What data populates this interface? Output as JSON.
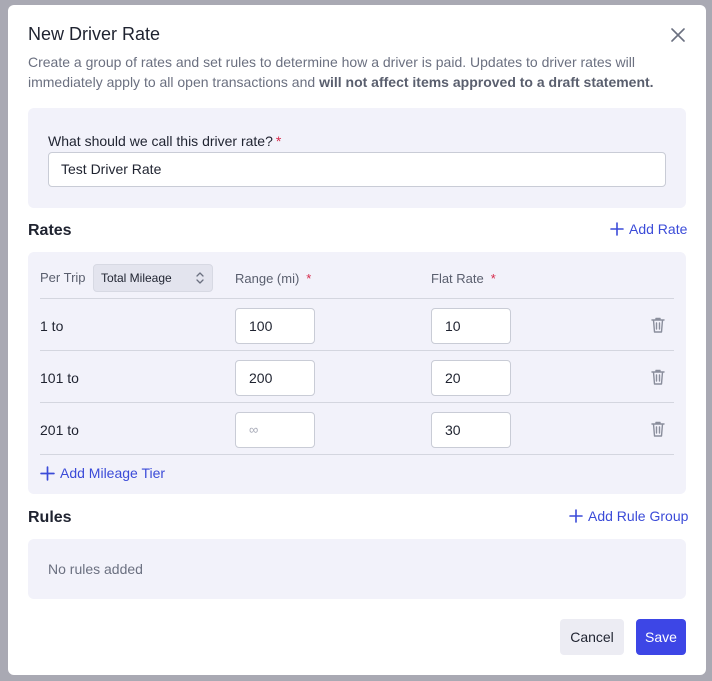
{
  "modal": {
    "title": "New Driver Rate",
    "description_part1": "Create a group of rates and set rules to determine how a driver is paid. Updates to driver rates will immediately apply to all open transactions and ",
    "description_bold": "will not affect items approved to a draft statement."
  },
  "name_field": {
    "label": "What should we call this driver rate?",
    "required_mark": "*",
    "value": "Test Driver Rate"
  },
  "rates": {
    "title": "Rates",
    "add_rate_label": "Add Rate",
    "per_trip_label": "Per Trip",
    "basis_select": "Total Mileage",
    "range_header": "Range (mi)",
    "flat_rate_header": "Flat Rate",
    "required_mark": "*",
    "tiers": [
      {
        "label": "1 to",
        "range_end": "100",
        "flat_rate": "10"
      },
      {
        "label": "101 to",
        "range_end": "200",
        "flat_rate": "20"
      },
      {
        "label": "201 to",
        "range_placeholder": "∞",
        "flat_rate": "30"
      }
    ],
    "add_tier_label": "Add Mileage Tier"
  },
  "rules": {
    "title": "Rules",
    "add_group_label": "Add Rule Group",
    "empty_text": "No rules added"
  },
  "footer": {
    "cancel_label": "Cancel",
    "save_label": "Save"
  },
  "colors": {
    "accent": "#3d46e6",
    "link": "#3b4bd8",
    "required": "#d6294a",
    "card_bg": "#f2f2fa"
  },
  "icons": {
    "close": "close-icon",
    "add": "plus-icon",
    "trash": "trash-icon",
    "select": "chevron-up-down-icon"
  }
}
